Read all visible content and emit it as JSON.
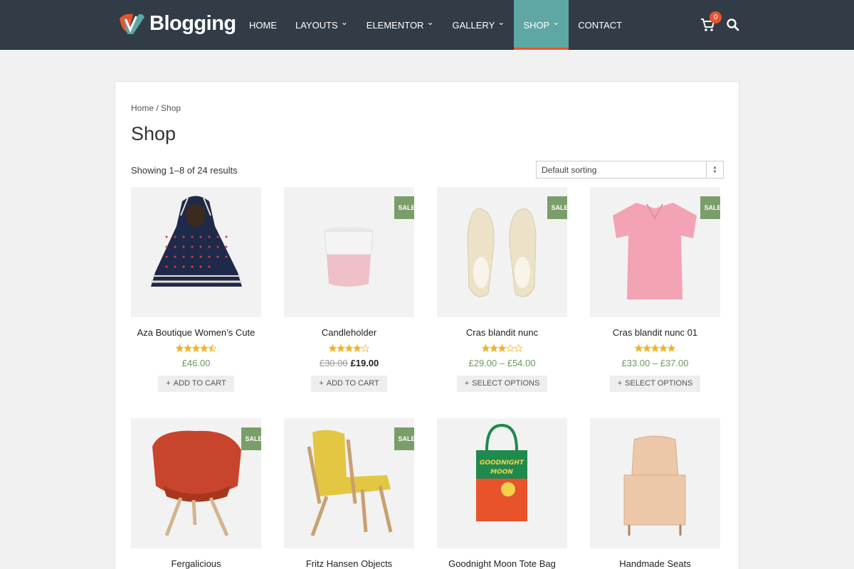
{
  "header": {
    "logo_text": "Blogging",
    "nav": [
      {
        "label": "HOME",
        "has_dropdown": false,
        "active": false
      },
      {
        "label": "LAYOUTS",
        "has_dropdown": true,
        "active": false
      },
      {
        "label": "ELEMENTOR",
        "has_dropdown": true,
        "active": false
      },
      {
        "label": "GALLERY",
        "has_dropdown": true,
        "active": false
      },
      {
        "label": "SHOP",
        "has_dropdown": true,
        "active": true
      },
      {
        "label": "CONTACT",
        "has_dropdown": false,
        "active": false
      }
    ],
    "cart_count": "0",
    "icons": {
      "cart": "cart-icon",
      "search": "search-icon"
    }
  },
  "breadcrumb": "Home / Shop",
  "page_title": "Shop",
  "result_count": "Showing 1–8 of 24 results",
  "sorting": {
    "selected": "Default sorting"
  },
  "colors": {
    "header_bg": "#323c47",
    "active_nav": "#5ea7a4",
    "accent": "#e8542f",
    "sale_badge": "#7a9e6a",
    "price": "#6a9a5a",
    "star": "#f0b429"
  },
  "products": [
    {
      "name": "Aza Boutique Women’s Cute",
      "rating": 4.5,
      "sale": false,
      "sale_label": "",
      "price": "£46.00",
      "old_price": "",
      "new_price": "",
      "button": "ADD TO CART",
      "image": "hooded-poncho"
    },
    {
      "name": "Candleholder",
      "rating": 4,
      "sale": true,
      "sale_label": "SALE!",
      "price": "",
      "old_price": "£30.00",
      "new_price": "£19.00",
      "button": "ADD TO CART",
      "image": "candleholder"
    },
    {
      "name": "Cras blandit nunc",
      "rating": 3,
      "sale": true,
      "sale_label": "SALE!",
      "price": "£29.00 – £54.00",
      "old_price": "",
      "new_price": "",
      "button": "SELECT OPTIONS",
      "image": "sneakers"
    },
    {
      "name": "Cras blandit nunc 01",
      "rating": 5,
      "sale": true,
      "sale_label": "SALE!",
      "price": "£33.00 – £37.00",
      "old_price": "",
      "new_price": "",
      "button": "SELECT OPTIONS",
      "image": "polo-shirt"
    },
    {
      "name": "Fergalicious",
      "rating": 0,
      "sale": true,
      "sale_label": "SALE!",
      "price": "",
      "old_price": "",
      "new_price": "",
      "button": "",
      "image": "red-chair"
    },
    {
      "name": "Fritz Hansen Objects",
      "rating": 0,
      "sale": true,
      "sale_label": "SALE!",
      "price": "",
      "old_price": "",
      "new_price": "",
      "button": "",
      "image": "yellow-armchair"
    },
    {
      "name": "Goodnight Moon Tote Bag",
      "rating": 0,
      "sale": false,
      "sale_label": "",
      "price": "",
      "old_price": "",
      "new_price": "",
      "button": "",
      "image": "tote-bag",
      "image_text": "GOODNIGHT MOON"
    },
    {
      "name": "Handmade Seats",
      "rating": 0,
      "sale": false,
      "sale_label": "",
      "price": "",
      "old_price": "",
      "new_price": "",
      "button": "",
      "image": "wingback-chair"
    }
  ]
}
